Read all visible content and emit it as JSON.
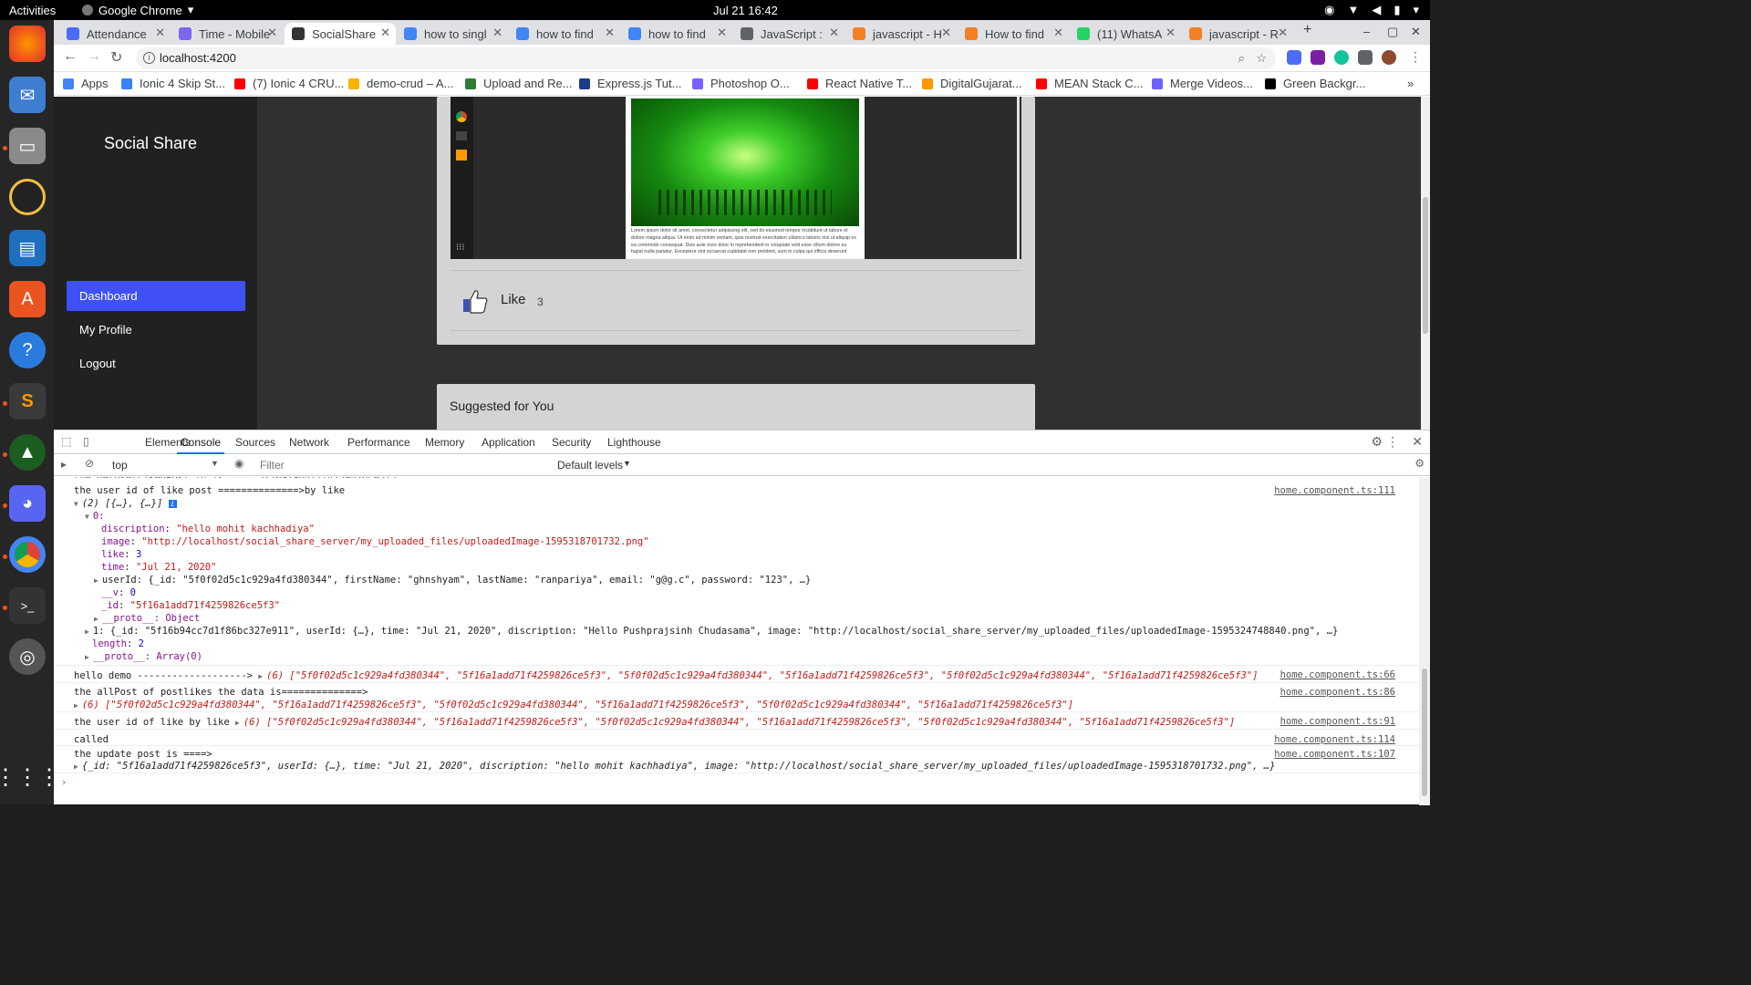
{
  "system": {
    "activities": "Activities",
    "app_name": "Google Chrome",
    "clock": "Jul 21  16:42"
  },
  "tabs": [
    {
      "label": "Attendance",
      "color": "#4a6cf7"
    },
    {
      "label": "Time - Mobile",
      "color": "#7b68ee"
    },
    {
      "label": "SocialShare",
      "color": "#333333"
    },
    {
      "label": "how to singl",
      "color": "#4285f4"
    },
    {
      "label": "how to find",
      "color": "#4285f4"
    },
    {
      "label": "how to find",
      "color": "#4285f4"
    },
    {
      "label": "JavaScript :",
      "color": "#5f6368"
    },
    {
      "label": "javascript - H",
      "color": "#f48024"
    },
    {
      "label": "How to find",
      "color": "#f48024"
    },
    {
      "label": "(11) WhatsA",
      "color": "#25d366"
    },
    {
      "label": "javascript - R",
      "color": "#f48024"
    }
  ],
  "url": "localhost:4200",
  "bookmarks": [
    {
      "label": "Apps",
      "color": "#4285f4"
    },
    {
      "label": "Ionic 4 Skip St...",
      "color": "#3880ff"
    },
    {
      "label": "(7) Ionic 4 CRU...",
      "color": "#ff0000"
    },
    {
      "label": "demo-crud – A...",
      "color": "#f4b400"
    },
    {
      "label": "Upload and Re...",
      "color": "#2e7d32"
    },
    {
      "label": "Express.js Tut...",
      "color": "#1e3a8a"
    },
    {
      "label": "Photoshop O...",
      "color": "#7b61ff"
    },
    {
      "label": "React Native T...",
      "color": "#ff0000"
    },
    {
      "label": "DigitalGujarat...",
      "color": "#ff9800"
    },
    {
      "label": "MEAN Stack C...",
      "color": "#ff0000"
    },
    {
      "label": "Merge Videos...",
      "color": "#6c63ff"
    },
    {
      "label": "Green Backgr...",
      "color": "#000000"
    }
  ],
  "sidebar": {
    "brand": "Social Share",
    "items": [
      {
        "label": "Dashboard"
      },
      {
        "label": "My Profile"
      },
      {
        "label": "Logout"
      }
    ]
  },
  "post": {
    "like_label": "Like",
    "like_count": "3",
    "lorem": "Lorem ipsum dolor sit amet, consectetur adipiscing elit, sed do eiusmod tempor incididunt ut labore et dolore magna aliqua. Ut enim ad minim veniam, quis nostrud exercitation ullamco laboris nisi ut aliquip ex ea commodo consequat. Duis aute irure dolor in reprehenderit in voluptate velit esse cillum dolore eu fugiat nulla pariatur. Excepteur sint occaecat cupidatat non proident, sunt in culpa qui officia deserunt"
  },
  "suggested": {
    "title": "Suggested for You"
  },
  "devtools": {
    "tabs": [
      "Elements",
      "Console",
      "Sources",
      "Network",
      "Performance",
      "Memory",
      "Application",
      "Security",
      "Lighthouse"
    ],
    "context": "top",
    "filter_placeholder": "Filter",
    "levels": "Default levels"
  },
  "console": {
    "l_liker_title": "the user id of like post ==============>by like",
    "l_liker_src": "home.component.ts:111",
    "l_array_head": "(2) [{…}, {…}]",
    "l_idx0": "0:",
    "l_disc_key": "discription",
    "l_disc_val": "\"hello mohit kachhadiya\"",
    "l_img_key": "image",
    "l_img_val": "\"http://localhost/social_share_server/my_uploaded_files/uploadedImage-1595318701732.png\"",
    "l_like_key": "like",
    "l_like_val": "3",
    "l_time_key": "time",
    "l_time_val": "\"Jul 21, 2020\"",
    "l_userid_line": "userId: {_id: \"5f0f02d5c1c929a4fd380344\", firstName: \"ghnshyam\", lastName: \"ranpariya\", email: \"g@g.c\", password: \"123\", …}",
    "l_v_key": "__v",
    "l_v_val": "0",
    "l_id_key": "_id",
    "l_id_val": "\"5f16a1add71f4259826ce5f3\"",
    "l_proto_obj": "__proto__: Object",
    "l_idx1_line": "1: {_id: \"5f16b94cc7d1f86bc327e911\", userId: {…}, time: \"Jul 21, 2020\", discription: \"Hello Pushprajsinh Chudasama\", image: \"http://localhost/social_share_server/my_uploaded_files/uploadedImage-1595324748840.png\", …}",
    "l_length_key": "length",
    "l_length_val": "2",
    "l_proto_arr": "__proto__: Array(0)",
    "l_demo_text": "hello demo ------------------->",
    "l_demo_arr": "(6) [\"5f0f02d5c1c929a4fd380344\", \"5f16a1add71f4259826ce5f3\", \"5f0f02d5c1c929a4fd380344\", \"5f16a1add71f4259826ce5f3\", \"5f0f02d5c1c929a4fd380344\", \"5f16a1add71f4259826ce5f3\"]",
    "l_demo_src": "home.component.ts:66",
    "l_all_text": "the allPost of postlikes the data is==============>",
    "l_all_arr": "(6) [\"5f0f02d5c1c929a4fd380344\", \"5f16a1add71f4259826ce5f3\", \"5f0f02d5c1c929a4fd380344\", \"5f16a1add71f4259826ce5f3\", \"5f0f02d5c1c929a4fd380344\", \"5f16a1add71f4259826ce5f3\"]",
    "l_all_src": "home.component.ts:86",
    "l_by_text": "the user id of like by like",
    "l_by_arr": "(6) [\"5f0f02d5c1c929a4fd380344\", \"5f16a1add71f4259826ce5f3\", \"5f0f02d5c1c929a4fd380344\", \"5f16a1add71f4259826ce5f3\", \"5f0f02d5c1c929a4fd380344\", \"5f16a1add71f4259826ce5f3\"]",
    "l_by_src": "home.component.ts:91",
    "l_called": "called",
    "l_called_src": "home.component.ts:114",
    "l_upd_text": "the update post is ====>",
    "l_upd_src": "home.component.ts:107",
    "l_upd_obj": "{_id: \"5f16a1add71f4259826ce5f3\", userId: {…}, time: \"Jul 21, 2020\", discription: \"hello mohit kachhadiya\", image: \"http://localhost/social_share_server/my_uploaded_files/uploadedImage-1595318701732.png\", …}"
  }
}
